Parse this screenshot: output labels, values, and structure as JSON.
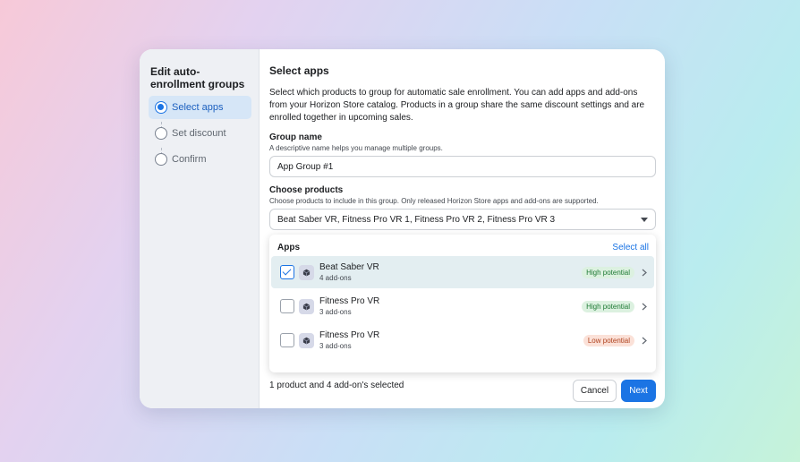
{
  "sidebar": {
    "title": "Edit auto-enrollment groups",
    "steps": [
      {
        "label": "Select apps",
        "active": true
      },
      {
        "label": "Set discount",
        "active": false
      },
      {
        "label": "Confirm",
        "active": false
      }
    ]
  },
  "main": {
    "title": "Select apps",
    "intro": "Select which products to group for automatic sale enrollment. You can add apps and add-ons from your Horizon Store catalog. Products in a group share the same discount settings and are enrolled together in upcoming sales.",
    "group_name": {
      "label": "Group name",
      "help": "A descriptive name helps you manage multiple groups.",
      "value": "App Group #1"
    },
    "choose_products": {
      "label": "Choose products",
      "help": "Choose products to include in this group. Only released Horizon Store apps and add-ons are supported.",
      "value": "Beat Saber VR, Fitness Pro VR 1, Fitness Pro VR 2, Fitness Pro VR 3"
    },
    "dropdown": {
      "title": "Apps",
      "select_all": "Select all",
      "items": [
        {
          "name": "Beat Saber VR",
          "addons": "4 add-ons",
          "badge": "High potential",
          "badge_type": "high",
          "checked": true
        },
        {
          "name": "Fitness Pro VR",
          "addons": "3 add-ons",
          "badge": "High potential",
          "badge_type": "high",
          "checked": false
        },
        {
          "name": "Fitness Pro VR",
          "addons": "3 add-ons",
          "badge": "Low potential",
          "badge_type": "low",
          "checked": false
        }
      ]
    },
    "footer": {
      "summary": "1 product and 4 add-on's selected",
      "cancel_label": "Cancel",
      "next_label": "Next"
    }
  },
  "colors": {
    "accent": "#1b74e4",
    "high_badge_bg": "#dcf1e0",
    "low_badge_bg": "#fbe1d8"
  },
  "icons": {
    "app_icon": "app-cube-icon",
    "row_chevron": "chevron-right-icon",
    "dropdown_caret": "caret-down-icon",
    "checkmark": "checkmark-icon"
  }
}
